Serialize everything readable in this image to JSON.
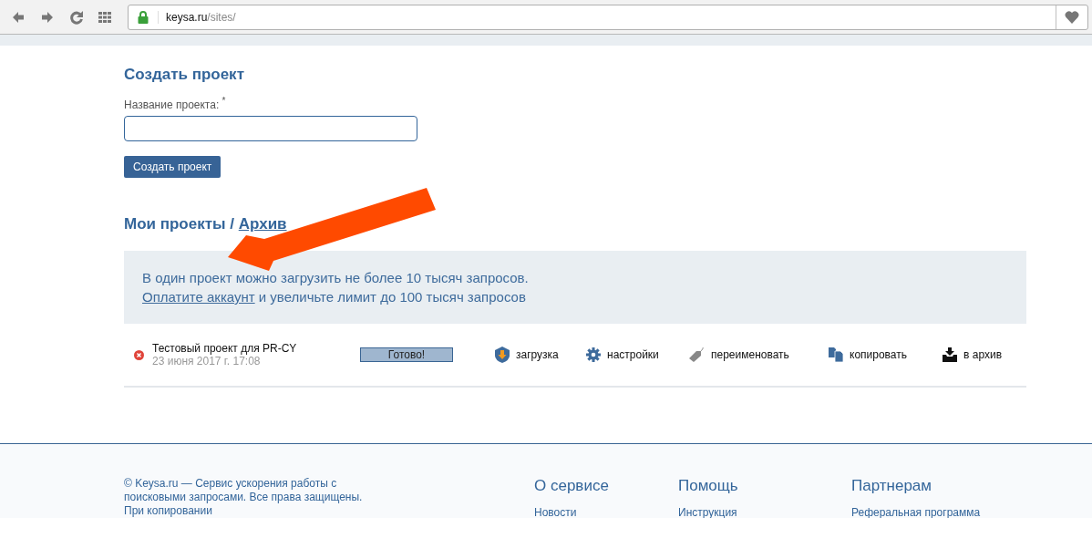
{
  "browser": {
    "url_host": "keysa.ru",
    "url_path": "/sites/"
  },
  "create": {
    "title": "Создать проект",
    "field_label": "Название проекта:",
    "required_mark": "*",
    "button": "Создать проект"
  },
  "projects": {
    "title": "Мои проекты / ",
    "archive_link": "Архив",
    "notice": {
      "line1": "В один проект можно загрузить не более 10 тысяч запросов.",
      "link": "Оплатите аккаунт",
      "line2_rest": " и увеличьте лимит до 100 тысяч запросов"
    },
    "rows": [
      {
        "name": "Тестовый проект для PR-CY",
        "date": "23 июня 2017 г. 17:08",
        "status": "Готово!",
        "level": 1,
        "actions": [
          {
            "kind": "upload",
            "label": "загрузка"
          },
          {
            "kind": "settings",
            "label": "настройки"
          },
          {
            "kind": "rename",
            "label": "переименовать"
          },
          {
            "kind": "copy",
            "label": "копировать"
          },
          {
            "kind": "archive",
            "label": "в архив"
          }
        ]
      }
    ]
  },
  "footer": {
    "about": "© Keysa.ru — Сервис ускорения работы с поисковыми запросами. Все права защищены. При копировании",
    "columns": [
      {
        "title": "О сервисе",
        "links": [
          "Новости"
        ]
      },
      {
        "title": "Помощь",
        "links": [
          "Инструкция"
        ]
      },
      {
        "title": "Партнерам",
        "links": [
          "Реферальная программа"
        ]
      }
    ]
  }
}
